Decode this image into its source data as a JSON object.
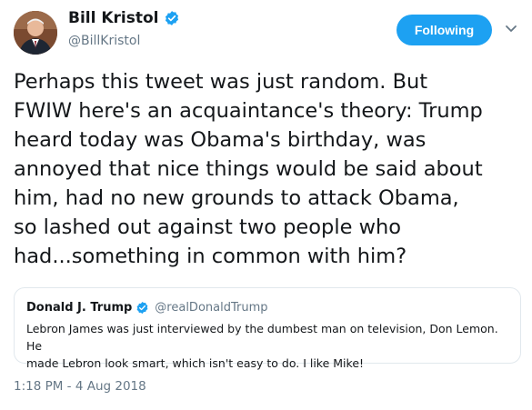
{
  "tweet": {
    "author": {
      "name": "Bill Kristol",
      "handle": "@BillKristol",
      "verified": true
    },
    "follow_label": "Following",
    "text": "Perhaps this tweet was just random. But\nFWIW here's an acquaintance's theory: Trump\nheard today was Obama's birthday, was\nannoyed that nice things would be said about\nhim, had no new grounds to attack Obama,\nso lashed out against two people who\nhad...something in common with him?",
    "timestamp": "1:18 PM - 4 Aug 2018"
  },
  "quote": {
    "author": {
      "name": "Donald J. Trump",
      "handle": "@realDonaldTrump",
      "verified": true
    },
    "text": "Lebron James was just interviewed by the dumbest man on television, Don Lemon. He\nmade Lebron look smart, which isn't easy to do. I like Mike!"
  },
  "colors": {
    "accent": "#1da1f2",
    "secondary_text": "#657786",
    "border": "#e1e8ed"
  },
  "icons": {
    "avatar": "avatar",
    "verified": "verified-badge-icon",
    "caret": "chevron-down-icon"
  }
}
